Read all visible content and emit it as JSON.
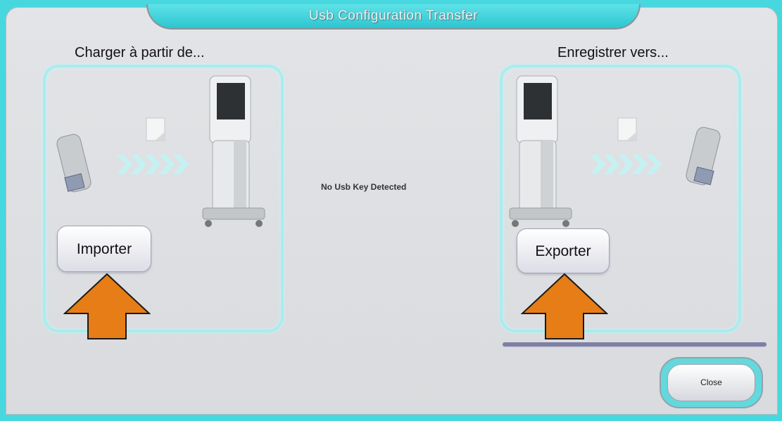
{
  "window": {
    "title": "Usb Configuration Transfer"
  },
  "import_section": {
    "heading": "Charger à partir de...",
    "button_label": "Importer"
  },
  "export_section": {
    "heading": "Enregistrer vers...",
    "button_label": "Exporter"
  },
  "status": {
    "message": "No Usb Key Detected"
  },
  "footer": {
    "close_label": "Close"
  },
  "colors": {
    "accent": "#47d8df",
    "arrow": "#e67d16",
    "panel": "#dcdee1",
    "progress": "#7d7fa4"
  }
}
